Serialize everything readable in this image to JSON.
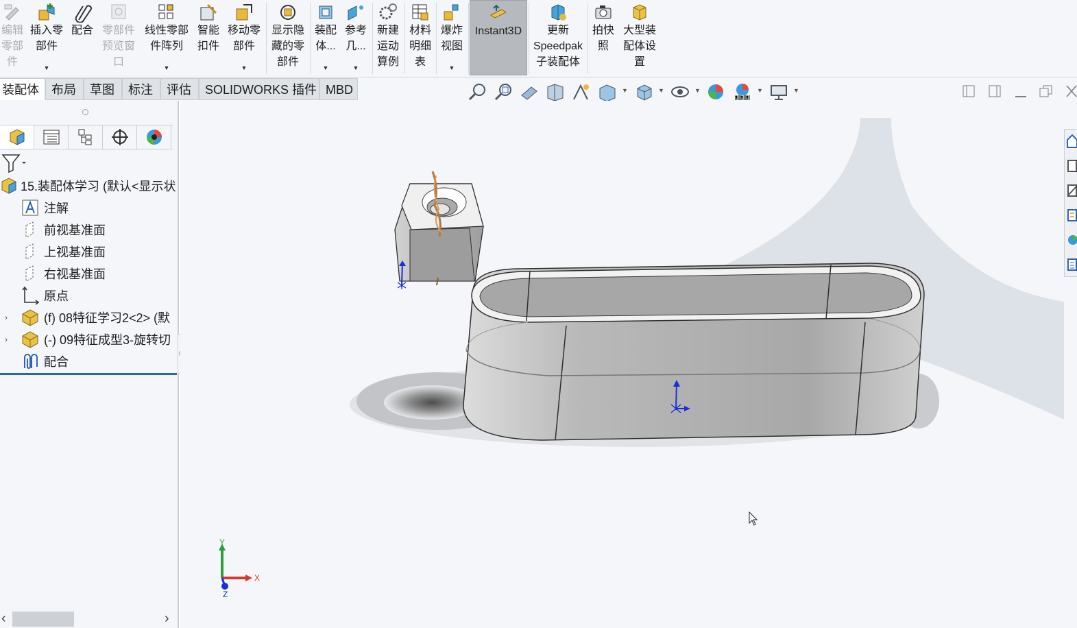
{
  "ribbon": {
    "buttons": [
      {
        "label": "编辑\n零部\n件",
        "icon": "edit-component-icon",
        "enabled": false
      },
      {
        "label": "插入零\n部件",
        "icon": "insert-component-icon",
        "enabled": true
      },
      {
        "label": "配合",
        "icon": "mate-paperclip-icon",
        "enabled": true
      },
      {
        "label": "零部件\n预览窗\n口",
        "icon": "component-preview-icon",
        "enabled": false
      },
      {
        "label": "线性零部\n件阵列",
        "icon": "linear-pattern-icon",
        "enabled": true
      },
      {
        "label": "智能\n扣件",
        "icon": "smart-fasteners-icon",
        "enabled": true
      },
      {
        "label": "移动零\n部件",
        "icon": "move-component-icon",
        "enabled": true
      },
      {
        "label": "显示隐\n藏的零\n部件",
        "icon": "show-hidden-icon",
        "enabled": true
      },
      {
        "label": "装配\n体...",
        "icon": "assembly-features-icon",
        "enabled": true
      },
      {
        "label": "参考\n几...",
        "icon": "reference-geometry-icon",
        "enabled": true
      },
      {
        "label": "新建\n运动\n算例",
        "icon": "motion-study-icon",
        "enabled": true
      },
      {
        "label": "材料\n明细\n表",
        "icon": "bom-table-icon",
        "enabled": true
      },
      {
        "label": "爆炸\n视图",
        "icon": "exploded-view-icon",
        "enabled": true
      },
      {
        "label": "Instant3D",
        "icon": "instant3d-icon",
        "enabled": true
      },
      {
        "label": "更新\nSpeedpak\n子装配体",
        "icon": "speedpak-icon",
        "enabled": true
      },
      {
        "label": "拍快\n照",
        "icon": "snapshot-camera-icon",
        "enabled": true
      },
      {
        "label": "大型装\n配体设\n置",
        "icon": "large-assembly-icon",
        "enabled": true
      }
    ]
  },
  "tabs": [
    {
      "label": "装配体",
      "active": true
    },
    {
      "label": "布局",
      "active": false
    },
    {
      "label": "草图",
      "active": false
    },
    {
      "label": "标注",
      "active": false
    },
    {
      "label": "评估",
      "active": false
    },
    {
      "label": "SOLIDWORKS 插件",
      "active": false
    },
    {
      "label": "MBD",
      "active": false
    }
  ],
  "heads_up_toolbar": [
    "zoom-to-fit-icon",
    "zoom-to-area-icon",
    "previous-view-icon",
    "section-view-icon",
    "dynamic-annotation-icon",
    "view-orientation-icon",
    "display-style-icon",
    "hide-show-items-icon",
    "edit-appearance-icon",
    "apply-scene-icon",
    "view-settings-icon"
  ],
  "feature_manager": {
    "tabs": [
      "feature-manager-icon",
      "property-manager-icon",
      "configuration-manager-icon",
      "dimxpert-icon",
      "display-manager-icon"
    ],
    "tree": [
      {
        "text": "15.装配体学习  (默认<显示状",
        "icon": "assembly-icon",
        "expander": ""
      },
      {
        "text": "注解",
        "icon": "annotations-icon",
        "expander": ""
      },
      {
        "text": "前视基准面",
        "icon": "plane-icon",
        "expander": ""
      },
      {
        "text": "上视基准面",
        "icon": "plane-icon",
        "expander": ""
      },
      {
        "text": "右视基准面",
        "icon": "plane-icon",
        "expander": ""
      },
      {
        "text": "原点",
        "icon": "origin-icon",
        "expander": ""
      },
      {
        "text": "(f) 08特征学习2<2> (默",
        "icon": "part-icon",
        "expander": "›"
      },
      {
        "text": "(-) 09特征成型3-旋转切",
        "icon": "part-icon",
        "expander": "›"
      },
      {
        "text": "配合",
        "icon": "mates-icon",
        "expander": ""
      }
    ]
  },
  "triad": {
    "x": "X",
    "y": "Y",
    "z": "Z"
  },
  "colors": {
    "accent": "#2f63b8",
    "viewport_bg": "#f4f6f9",
    "part_gray": "#a9a9a9"
  }
}
